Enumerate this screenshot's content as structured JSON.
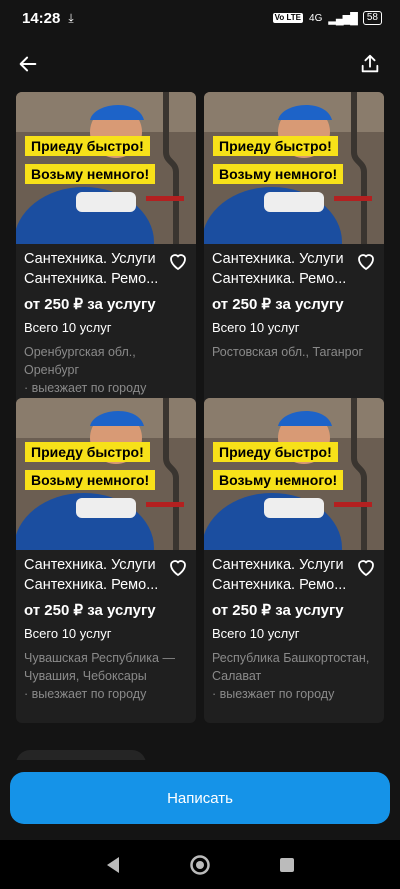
{
  "status_bar": {
    "time": "14:28",
    "network": "4G",
    "lte_label": "Vo LTE",
    "battery": "58"
  },
  "cards": [
    {
      "banner_line1": "Приеду быстро!",
      "banner_line2": "Возьму немного!",
      "title_line1": "Сантехника. Услуги",
      "title_line2": "Сантехника. Ремо...",
      "price": "от 250 ₽ за услугу",
      "count": "Всего 10 услуг",
      "location_line1": "Оренбургская обл.,",
      "location_line2": "Оренбург",
      "trip": "· выезжает по городу"
    },
    {
      "banner_line1": "Приеду быстро!",
      "banner_line2": "Возьму немного!",
      "title_line1": "Сантехника. Услуги",
      "title_line2": "Сантехника. Ремо...",
      "price": "от 250 ₽ за услугу",
      "count": "Всего 10 услуг",
      "location_line1": "Ростовская обл., Таганрог"
    },
    {
      "banner_line1": "Приеду быстро!",
      "banner_line2": "Возьму немного!",
      "title_line1": "Сантехника. Услуги",
      "title_line2": "Сантехника. Ремо...",
      "price": "от 250 ₽ за услугу",
      "count": "Всего 10 услуг",
      "location_line1": "Чувашская Республика —",
      "location_line2": "Чувашия, Чебоксары",
      "trip": "· выезжает по городу"
    },
    {
      "banner_line1": "Приеду быстро!",
      "banner_line2": "Возьму немного!",
      "title_line1": "Сантехника. Услуги",
      "title_line2": "Сантехника. Ремо...",
      "price": "от 250 ₽ за услугу",
      "count": "Всего 10 услуг",
      "location_line1": "Республика Башкортостан,",
      "location_line2": "Салават",
      "trip": "· выезжает по городу"
    }
  ],
  "cta": {
    "label": "Написать"
  },
  "colors": {
    "accent": "#1593e8",
    "banner": "#f7e119",
    "background": "#141414",
    "card": "#1f1f1f"
  },
  "icons": {
    "back": "arrow-left-icon",
    "share": "share-icon",
    "favorite": "heart-outline-icon"
  }
}
